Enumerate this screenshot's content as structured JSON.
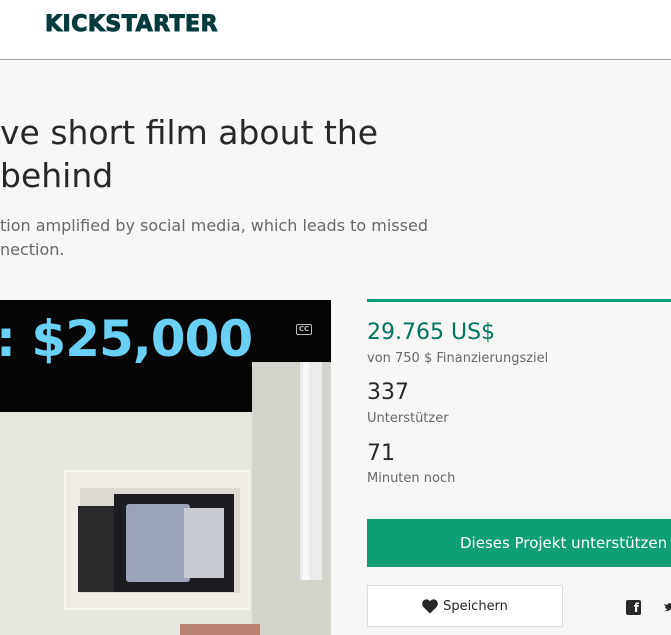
{
  "header": {
    "logo_text": "KICKSTARTER"
  },
  "project": {
    "title_lines": [
      "ve short film about the",
      "behind"
    ],
    "blurb_lines": [
      "tion amplified by social media, which leads to missed",
      "nection."
    ]
  },
  "video": {
    "overlay_amount": ": $25,000",
    "cc_label": "CC",
    "overlay_color": "#6bd0f5"
  },
  "stats": {
    "pledged": "29.765 US$",
    "goal": "von 750 $ Finanzierungsziel",
    "backers_count": "337",
    "backers_label": "Unterstützer",
    "time_count": "71",
    "time_label": "Minuten noch"
  },
  "actions": {
    "back_label": "Dieses Projekt unterstützen",
    "save_label": "Speichern"
  },
  "icons": {
    "save": "heart-icon",
    "share_facebook": "facebook-icon",
    "share_twitter": "twitter-icon",
    "captions": "closed-captions-icon"
  },
  "colors": {
    "brand": "#053b3d",
    "accent_green": "#109e74",
    "pledged_green": "#037362"
  }
}
